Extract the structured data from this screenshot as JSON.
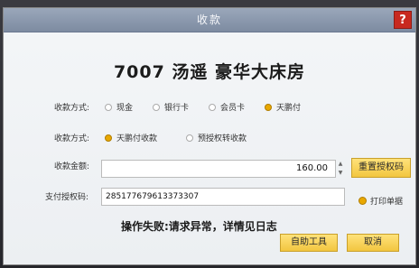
{
  "dialog": {
    "title": "收款",
    "help_label": "?"
  },
  "heading": "7007  汤遥  豪华大床房",
  "payment_method": {
    "label": "收款方式:",
    "options": [
      {
        "label": "现金",
        "selected": false
      },
      {
        "label": "银行卡",
        "selected": false
      },
      {
        "label": "会员卡",
        "selected": false
      },
      {
        "label": "天鹏付",
        "selected": true
      }
    ]
  },
  "collection_mode": {
    "label": "收款方式:",
    "options": [
      {
        "label": "天鹏付收款",
        "selected": true
      },
      {
        "label": "预授权转收款",
        "selected": false
      }
    ]
  },
  "amount": {
    "label": "收款金额:",
    "value": "160.00"
  },
  "auth_code": {
    "label": "支付授权码:",
    "value": "285177679613373307"
  },
  "buttons": {
    "reset_auth": "重置授权码",
    "self_tool": "自助工具",
    "cancel": "取消"
  },
  "print_receipt": {
    "label": "打印单据",
    "checked": true
  },
  "status_message": "操作失败:请求异常，详情见日志",
  "colors": {
    "accent": "#f2c640",
    "titlebar": "#8a97ad",
    "help": "#c8291f"
  }
}
